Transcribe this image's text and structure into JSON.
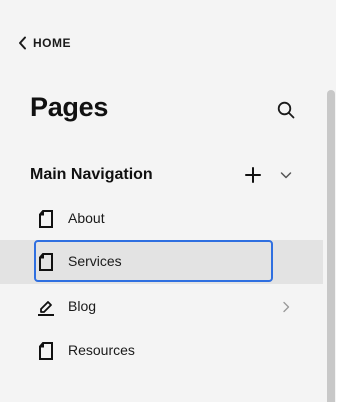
{
  "header": {
    "back_label": "HOME",
    "title": "Pages"
  },
  "navigation": {
    "section_title": "Main Navigation",
    "items": [
      {
        "label": "About",
        "icon": "page-icon",
        "selected": false
      },
      {
        "label": "Services",
        "icon": "page-icon",
        "selected": true
      },
      {
        "label": "Blog",
        "icon": "blog-edit-icon",
        "selected": false,
        "has_children": true
      },
      {
        "label": "Resources",
        "icon": "page-icon",
        "selected": false
      }
    ]
  },
  "colors": {
    "panel_bg": "#f4f4f4",
    "selected_bg": "#e3e3e3",
    "selection_border": "#2f6fe0",
    "text": "#111111"
  }
}
